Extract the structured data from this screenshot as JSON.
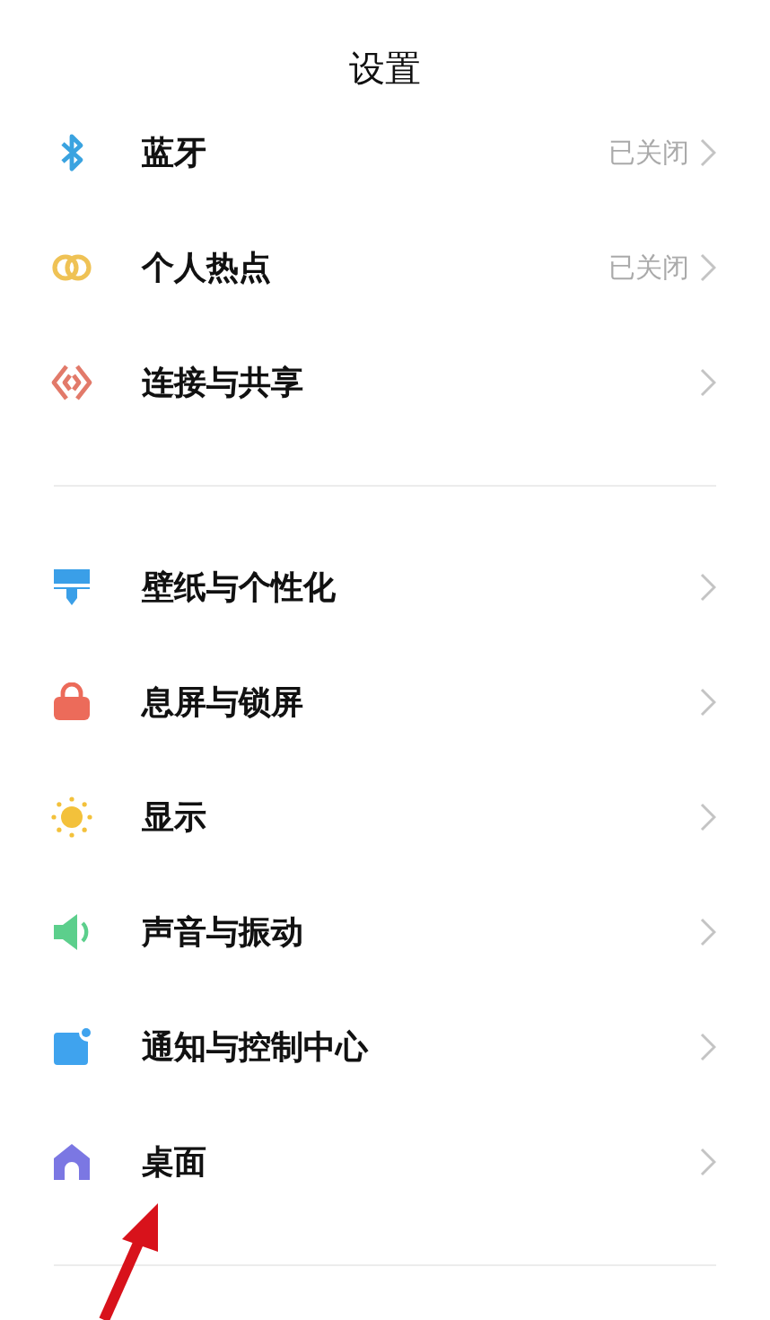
{
  "title": "设置",
  "groups": [
    {
      "items": [
        {
          "label": "蓝牙",
          "value": "已关闭"
        },
        {
          "label": "个人热点",
          "value": "已关闭"
        },
        {
          "label": "连接与共享"
        }
      ]
    },
    {
      "items": [
        {
          "label": "壁纸与个性化"
        },
        {
          "label": "息屏与锁屏"
        },
        {
          "label": "显示"
        },
        {
          "label": "声音与振动"
        },
        {
          "label": "通知与控制中心"
        },
        {
          "label": "桌面"
        }
      ]
    }
  ],
  "annotation": {
    "kind": "arrow"
  }
}
